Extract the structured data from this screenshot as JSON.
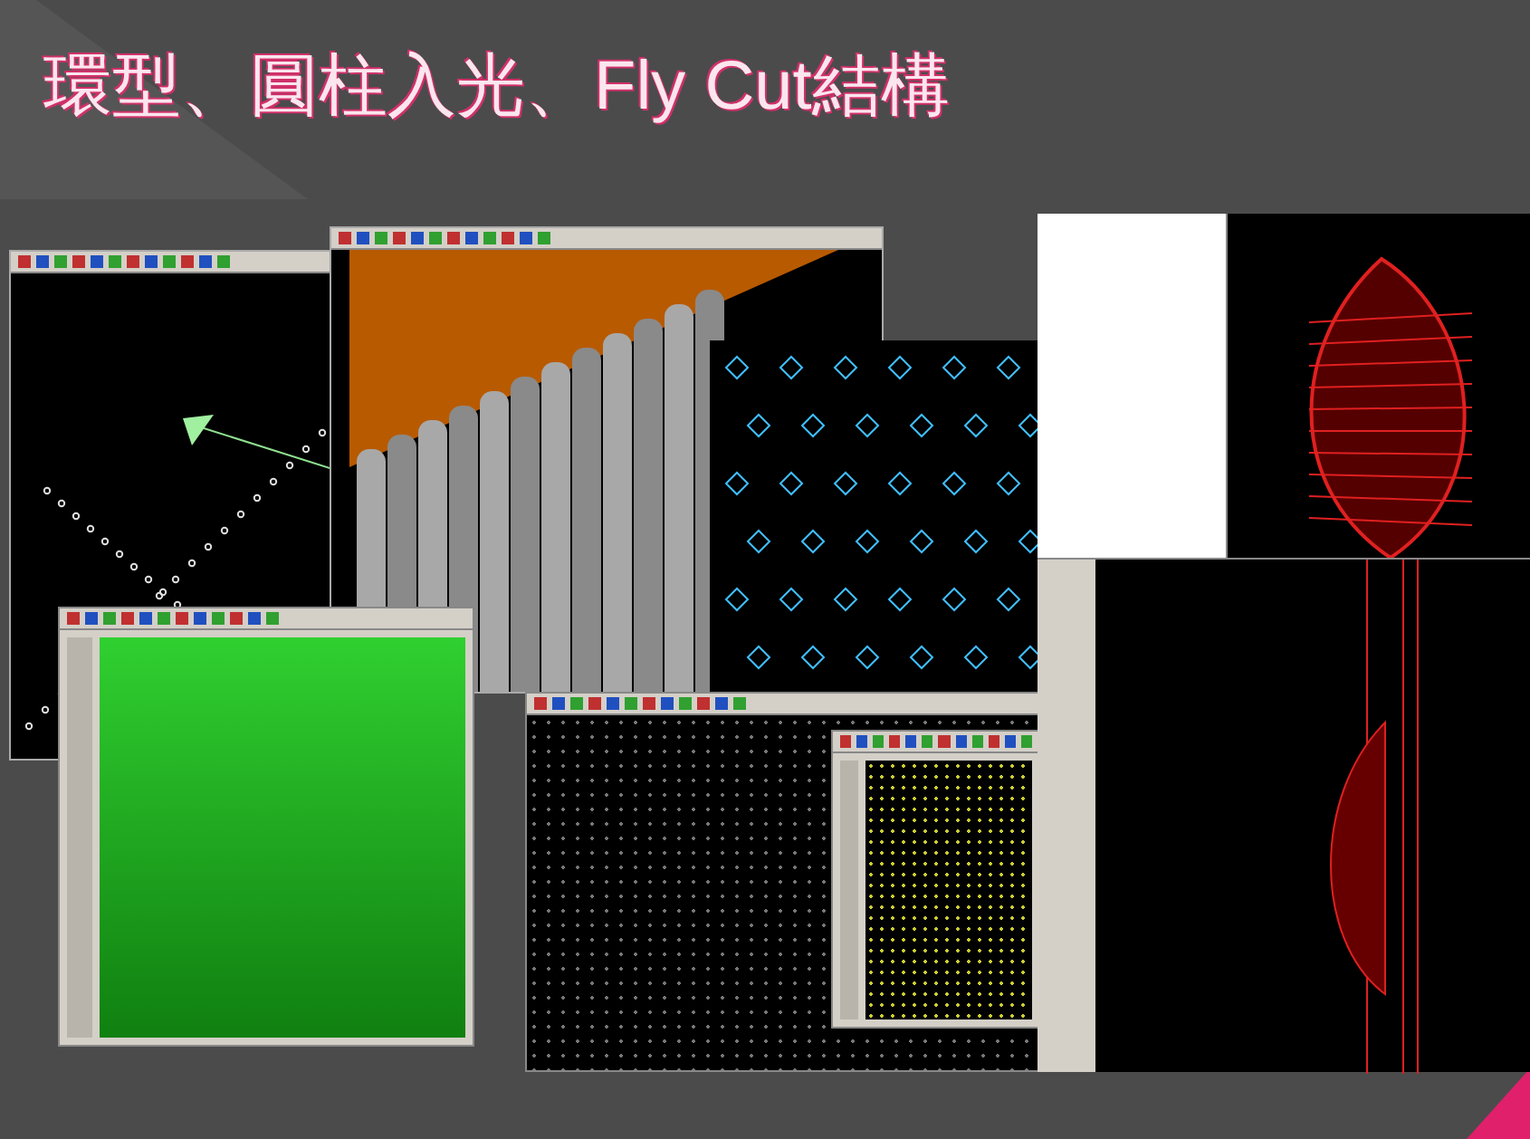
{
  "slide": {
    "title": "環型、圓柱入光、Fly Cut結構"
  }
}
